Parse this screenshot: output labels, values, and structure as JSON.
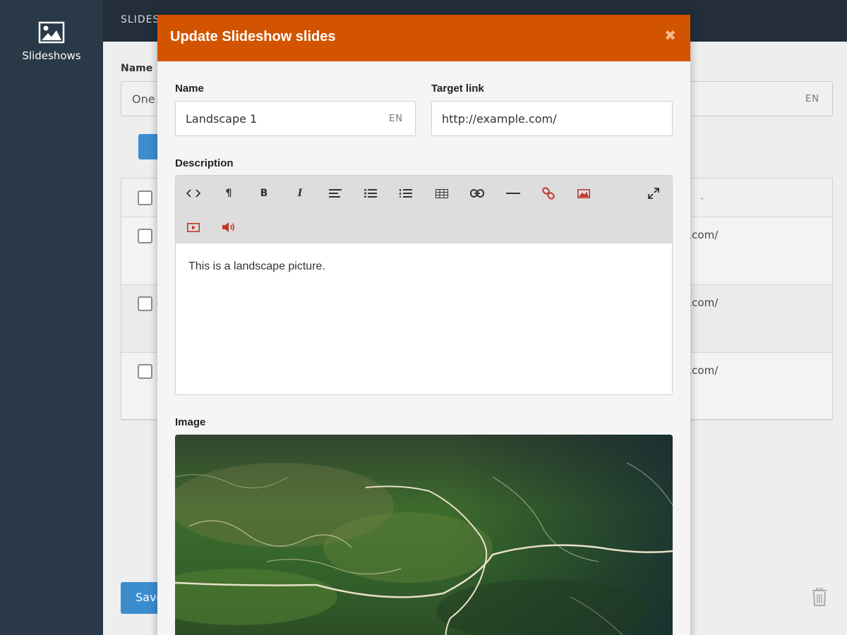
{
  "sidebar": {
    "items": [
      {
        "label": "Slideshows",
        "icon": "image-icon"
      }
    ]
  },
  "topbar": {
    "title": "SLIDES"
  },
  "background": {
    "name_label": "Name",
    "name_value": "One",
    "name_lang": "EN",
    "rows": [
      {
        "link": "le.com/"
      },
      {
        "link": "le.com/"
      },
      {
        "link": "le.com/"
      }
    ],
    "save_label": "Save"
  },
  "modal": {
    "title": "Update Slideshow slides",
    "close_icon": "close-icon",
    "name_label": "Name",
    "name_value": "Landscape 1",
    "name_lang": "EN",
    "target_label": "Target link",
    "target_value": "http://example.com/",
    "description_label": "Description",
    "description_text": "This is a landscape picture.",
    "image_label": "Image",
    "toolbar": [
      {
        "icon": "code-icon",
        "glyph": "<>"
      },
      {
        "icon": "paragraph-icon",
        "glyph": "¶"
      },
      {
        "icon": "bold-icon",
        "glyph": "B"
      },
      {
        "icon": "italic-icon",
        "glyph": "I"
      },
      {
        "icon": "align-icon"
      },
      {
        "icon": "unordered-list-icon"
      },
      {
        "icon": "ordered-list-icon"
      },
      {
        "icon": "table-icon"
      },
      {
        "icon": "link-icon"
      },
      {
        "icon": "horizontal-rule-icon"
      },
      {
        "icon": "unlink-icon"
      },
      {
        "icon": "insert-image-icon"
      },
      {
        "icon": "fullscreen-icon"
      },
      {
        "icon": "insert-video-icon"
      },
      {
        "icon": "insert-audio-icon"
      }
    ]
  },
  "colors": {
    "sidebar": "#2a3947",
    "topbar": "#232e3a",
    "modal_header": "#d35400",
    "accent_red": "#c0392b",
    "button_blue": "#3c8dd0"
  }
}
